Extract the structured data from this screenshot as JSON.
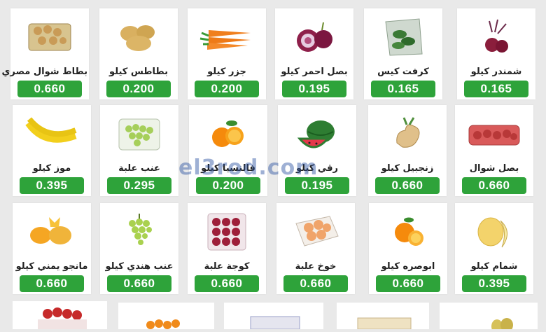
{
  "watermark": "el3rod.com",
  "products": [
    {
      "name": "بطاط شوال مصري",
      "price": "0.660",
      "icon": "potato-sack-icon"
    },
    {
      "name": "بطاطس كيلو",
      "price": "0.200",
      "icon": "potato-icon"
    },
    {
      "name": "جزر كيلو",
      "price": "0.200",
      "icon": "carrot-icon"
    },
    {
      "name": "بصل احمر كيلو",
      "price": "0.195",
      "icon": "red-onion-icon"
    },
    {
      "name": "كرفت كيس",
      "price": "0.165",
      "icon": "leaf-bag-icon"
    },
    {
      "name": "شمندر كيلو",
      "price": "0.165",
      "icon": "beetroot-icon"
    },
    {
      "name": "موز كيلو",
      "price": "0.395",
      "icon": "banana-icon"
    },
    {
      "name": "عنب علبة",
      "price": "0.295",
      "icon": "grape-box-icon"
    },
    {
      "name": "فالنسيا كيلو",
      "price": "0.200",
      "icon": "orange-icon"
    },
    {
      "name": "رقي كيلو",
      "price": "0.195",
      "icon": "watermelon-icon"
    },
    {
      "name": "زنجبيل كيلو",
      "price": "0.660",
      "icon": "ginger-icon"
    },
    {
      "name": "بصل شوال",
      "price": "0.660",
      "icon": "onion-sack-icon"
    },
    {
      "name": "مانجو يمني كيلو",
      "price": "0.660",
      "icon": "mango-icon"
    },
    {
      "name": "عنب هندي كيلو",
      "price": "0.660",
      "icon": "green-grapes-icon"
    },
    {
      "name": "كوجة علبة",
      "price": "0.660",
      "icon": "plum-box-icon"
    },
    {
      "name": "خوخ علبة",
      "price": "0.660",
      "icon": "peach-box-icon"
    },
    {
      "name": "ابوصره كيلو",
      "price": "0.660",
      "icon": "orange-halves-icon"
    },
    {
      "name": "شمام كيلو",
      "price": "0.395",
      "icon": "melon-icon"
    }
  ]
}
